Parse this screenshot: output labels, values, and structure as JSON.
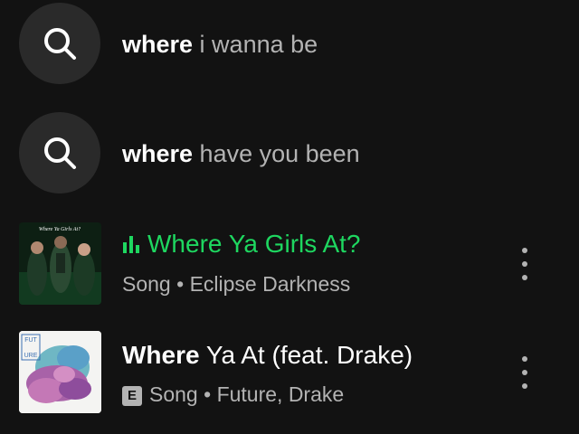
{
  "suggestions": [
    {
      "bold": "where",
      "rest": " i wanna be",
      "icon": "search-icon"
    },
    {
      "bold": "where",
      "rest": " have you been",
      "icon": "search-icon"
    }
  ],
  "results": [
    {
      "title": "Where Ya Girls At?",
      "title_color": "#1ed760",
      "playing_icon": "equalizer-icon",
      "type": "Song",
      "separator": " • ",
      "artist": "Eclipse Darkness",
      "artwork_text": "Where Ya Girls At?",
      "more_icon": "more-vertical-icon"
    },
    {
      "title_bold": "Where",
      "title_rest": " Ya At (feat. Drake)",
      "explicit": "E",
      "type": "Song",
      "separator": " • ",
      "artist": "Future, Drake",
      "artwork_text": "FUT URE",
      "more_icon": "more-vertical-icon"
    }
  ],
  "colors": {
    "background": "#121212",
    "accent": "#1ed760",
    "secondary_text": "#b3b3b3"
  }
}
